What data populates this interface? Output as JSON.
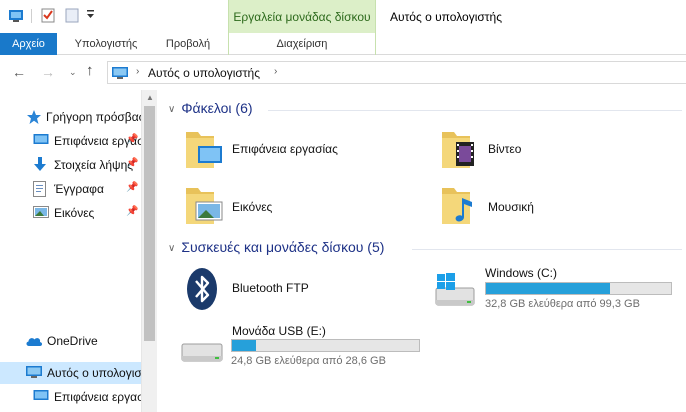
{
  "window": {
    "title": "Αυτός ο υπολογιστής",
    "contextual_tab_group": "Εργαλεία μονάδας δίσκου"
  },
  "ribbon": {
    "tabs": [
      {
        "label": "Αρχείο"
      },
      {
        "label": "Υπολογιστής"
      },
      {
        "label": "Προβολή"
      },
      {
        "label": "Διαχείριση"
      }
    ]
  },
  "address": {
    "path": "Αυτός ο υπολογιστής",
    "back_glyph": "←",
    "forward_glyph": "→",
    "recent_glyph": "⌄",
    "up_glyph": "↑",
    "separator_glyph": "›"
  },
  "nav_pane": {
    "items": [
      {
        "label": "Γρήγορη πρόσβαση",
        "icon": "star-icon"
      },
      {
        "label": "Επιφάνεια εργασίας",
        "icon": "desktop-icon",
        "pinned": true
      },
      {
        "label": "Στοιχεία λήψης",
        "icon": "download-arrow-icon",
        "pinned": true
      },
      {
        "label": "Έγγραφα",
        "icon": "document-icon",
        "pinned": true
      },
      {
        "label": "Εικόνες",
        "icon": "pictures-icon",
        "pinned": true
      },
      {
        "label": "OneDrive",
        "icon": "cloud-icon"
      },
      {
        "label": "Αυτός ο υπολογιστής",
        "icon": "computer-icon",
        "selected": true
      },
      {
        "label": "Επιφάνεια εργασίας",
        "icon": "desktop-icon"
      }
    ],
    "pin_glyph": "📌"
  },
  "folders_group": {
    "header": "Φάκελοι (6)",
    "items": [
      {
        "label": "Επιφάνεια εργασίας",
        "icon": "desktop-folder-icon"
      },
      {
        "label": "Βίντεο",
        "icon": "videos-folder-icon"
      },
      {
        "label": "Εικόνες",
        "icon": "pictures-folder-icon"
      },
      {
        "label": "Μουσική",
        "icon": "music-folder-icon"
      }
    ]
  },
  "devices_group": {
    "header": "Συσκευές και μονάδες δίσκου (5)",
    "items": [
      {
        "label": "Bluetooth FTP",
        "icon": "bluetooth-icon"
      },
      {
        "label": "Windows (C:)",
        "icon": "windows-drive-icon",
        "info": "32,8 GB ελεύθερα από 99,3 GB",
        "used_fraction": 0.67
      },
      {
        "label": "Μονάδα USB (E:)",
        "icon": "usb-drive-icon",
        "info": "24,8 GB ελεύθερα από 28,6 GB",
        "used_fraction": 0.13
      }
    ]
  },
  "colors": {
    "accent": "#1979ca",
    "contextual": "#dcefc8",
    "selection": "#cce8ff",
    "capacity_bar": "#26a0da",
    "group_header": "#1e3287"
  }
}
